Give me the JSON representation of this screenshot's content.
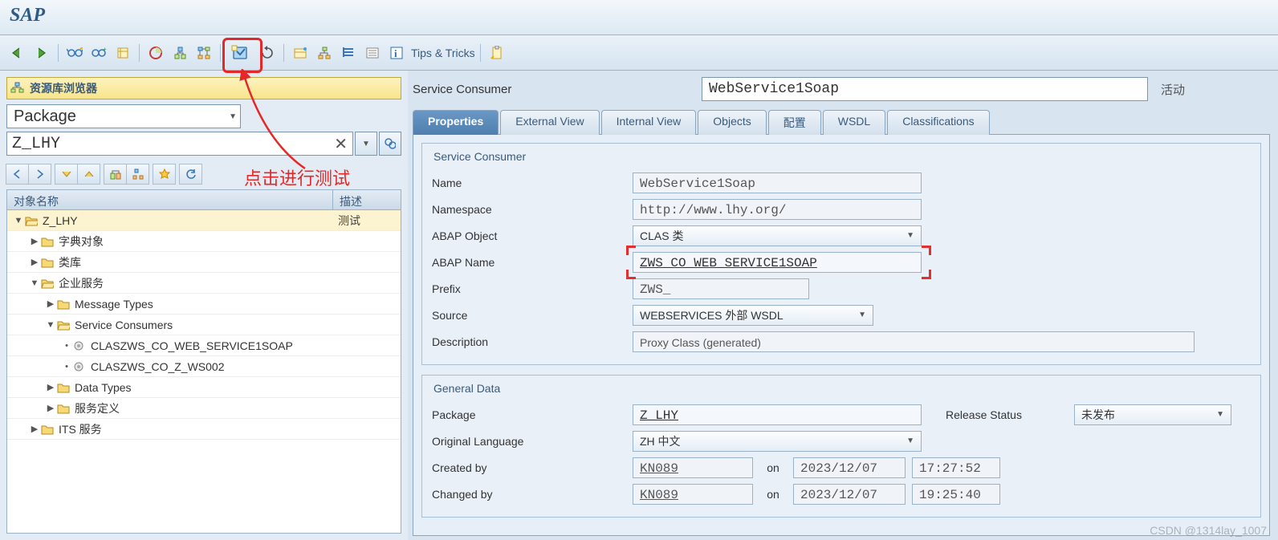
{
  "title": "SAP",
  "toolbar": {
    "tips_label": "Tips & Tricks"
  },
  "annotation": {
    "text": "点击进行测试"
  },
  "sidebar": {
    "browser_title": "资源库浏览器",
    "selector_value": "Package",
    "package_value": "Z_LHY",
    "tree_headers": {
      "name": "对象名称",
      "desc": "描述"
    },
    "tree": [
      {
        "lvl": 0,
        "label": "Z_LHY",
        "open": true,
        "sel": true,
        "desc": "测试",
        "folder": true
      },
      {
        "lvl": 1,
        "label": "字典对象",
        "open": false,
        "folder": true
      },
      {
        "lvl": 1,
        "label": "类库",
        "open": false,
        "folder": true
      },
      {
        "lvl": 1,
        "label": "企业服务",
        "open": true,
        "folder": true
      },
      {
        "lvl": 2,
        "label": "Message Types",
        "open": false,
        "folder": true
      },
      {
        "lvl": 2,
        "label": "Service Consumers",
        "open": true,
        "folder": true
      },
      {
        "lvl": 3,
        "label": "CLASZWS_CO_WEB_SERVICE1SOAP",
        "folder": false,
        "bullet": true
      },
      {
        "lvl": 3,
        "label": "CLASZWS_CO_Z_WS002",
        "folder": false,
        "bullet": true
      },
      {
        "lvl": 2,
        "label": "Data Types",
        "open": false,
        "folder": true
      },
      {
        "lvl": 2,
        "label": "服务定义",
        "open": false,
        "folder": true
      },
      {
        "lvl": 1,
        "label": "ITS 服务",
        "open": false,
        "folder": true
      }
    ]
  },
  "content": {
    "header_label": "Service Consumer",
    "header_value": "WebService1Soap",
    "header_status": "活动",
    "tabs": [
      "Properties",
      "External View",
      "Internal View",
      "Objects",
      "配置",
      "WSDL",
      "Classifications"
    ],
    "active_tab": 0,
    "group1": {
      "title": "Service Consumer",
      "name_label": "Name",
      "name_value": "WebService1Soap",
      "ns_label": "Namespace",
      "ns_value": "http://www.lhy.org/",
      "abap_obj_label": "ABAP Object",
      "abap_obj_value": "CLAS 类",
      "abap_name_label": "ABAP Name",
      "abap_name_value": "ZWS_CO_WEB_SERVICE1SOAP",
      "prefix_label": "Prefix",
      "prefix_value": "ZWS_",
      "source_label": "Source",
      "source_value": "WEBSERVICES 外部 WSDL",
      "desc_label": "Description",
      "desc_value": "Proxy Class (generated)"
    },
    "group2": {
      "title": "General Data",
      "pkg_label": "Package",
      "pkg_value": "Z_LHY",
      "rel_label": "Release Status",
      "rel_value": "未发布",
      "lang_label": "Original Language",
      "lang_value": "ZH 中文",
      "created_label": "Created by",
      "created_user": "KN089",
      "on_label": "on",
      "created_date": "2023/12/07",
      "created_time": "17:27:52",
      "changed_label": "Changed by",
      "changed_user": "KN089",
      "changed_date": "2023/12/07",
      "changed_time": "19:25:40"
    }
  },
  "watermark": "CSDN @1314lay_1007"
}
